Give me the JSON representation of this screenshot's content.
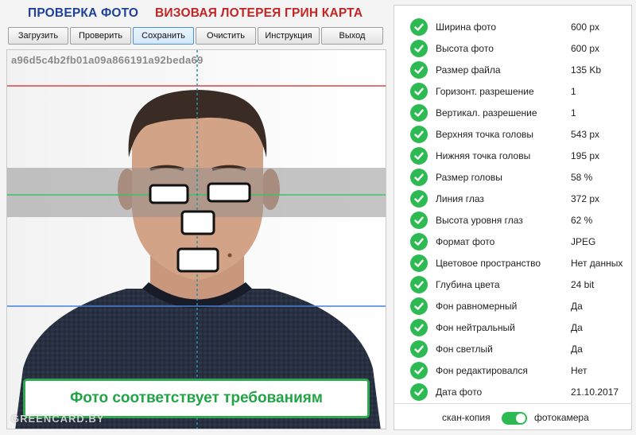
{
  "header": {
    "title_left": "ПРОВЕРКА ФОТО",
    "title_right": "ВИЗОВАЯ ЛОТЕРЕЯ ГРИН КАРТА"
  },
  "toolbar": {
    "load": "Загрузить",
    "check": "Проверить",
    "save": "Сохранить",
    "clear": "Очистить",
    "instructions": "Инструкция",
    "exit": "Выход"
  },
  "photo": {
    "hash": "a96d5c4b2fb01a09a866191a92beda69",
    "verdict": "Фото соответствует требованиям",
    "watermark": "GREENCARD.BY"
  },
  "results": [
    {
      "label": "Ширина фото",
      "value": "600 px",
      "status": "ok"
    },
    {
      "label": "Высота фото",
      "value": "600 px",
      "status": "ok"
    },
    {
      "label": "Размер файла",
      "value": "135 Kb",
      "status": "ok"
    },
    {
      "label": "Горизонт. разрешение",
      "value": "1",
      "status": "ok"
    },
    {
      "label": "Вертикал. разрешение",
      "value": "1",
      "status": "ok"
    },
    {
      "label": "Верхняя точка головы",
      "value": "543 px",
      "status": "ok"
    },
    {
      "label": "Нижняя точка головы",
      "value": "195 px",
      "status": "ok"
    },
    {
      "label": "Размер головы",
      "value": "58 %",
      "status": "ok"
    },
    {
      "label": "Линия глаз",
      "value": "372 px",
      "status": "ok"
    },
    {
      "label": "Высота уровня глаз",
      "value": "62 %",
      "status": "ok"
    },
    {
      "label": "Формат фото",
      "value": "JPEG",
      "status": "ok"
    },
    {
      "label": "Цветовое пространство",
      "value": "Нет данных",
      "status": "ok"
    },
    {
      "label": "Глубина цвета",
      "value": "24 bit",
      "status": "ok"
    },
    {
      "label": "Фон равномерный",
      "value": "Да",
      "status": "ok"
    },
    {
      "label": "Фон нейтральный",
      "value": "Да",
      "status": "ok"
    },
    {
      "label": "Фон светлый",
      "value": "Да",
      "status": "ok"
    },
    {
      "label": "Фон редактировался",
      "value": "Нет",
      "status": "ok"
    },
    {
      "label": "Дата фото",
      "value": "21.10.2017",
      "status": "ok"
    }
  ],
  "source_switch": {
    "left_label": "скан-копия",
    "right_label": "фотокамера",
    "selected": "фотокамера"
  },
  "colors": {
    "title_blue": "#1f3f9c",
    "title_red": "#c32424",
    "ok_green": "#2dba52",
    "verdict_green": "#22a446"
  }
}
